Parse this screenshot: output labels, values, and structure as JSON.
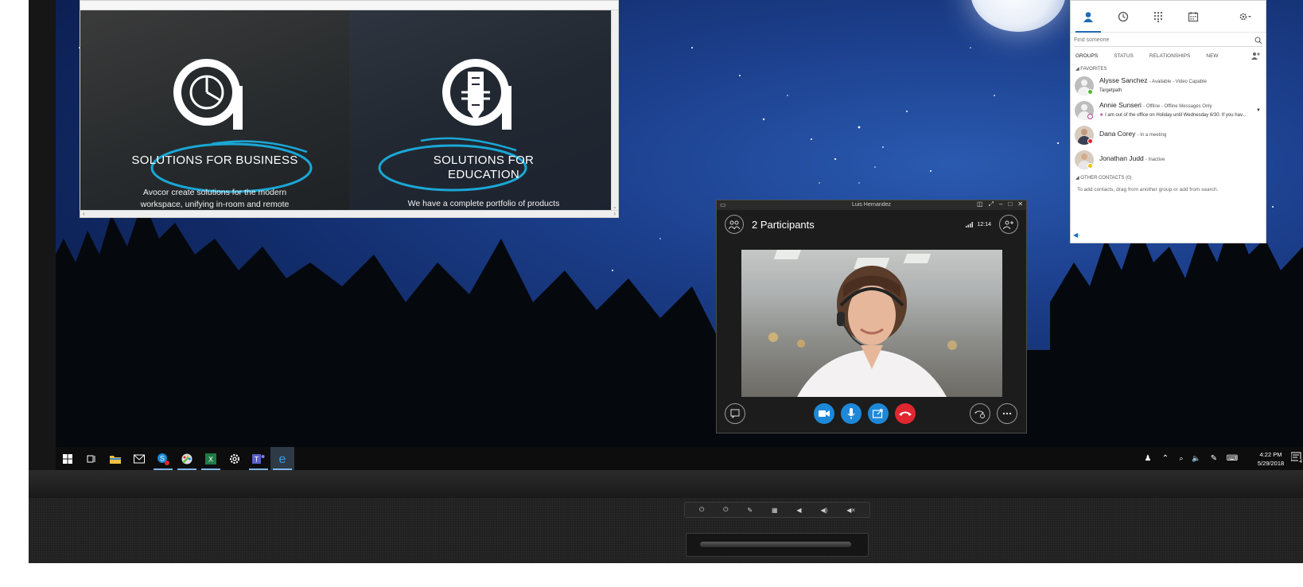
{
  "browser": {
    "panels": [
      {
        "title": "SOLUTIONS FOR BUSINESS",
        "desc_line1": "Avocor create solutions for the modern",
        "desc_line2": "workspace, unifying in-room and remote"
      },
      {
        "title_line1": "SOLUTIONS FOR",
        "title_line2": "EDUCATION",
        "desc_line1": "We have a complete portfolio of products"
      }
    ]
  },
  "contacts": {
    "search_placeholder": "Find someone",
    "subtabs": [
      "GROUPS",
      "STATUS",
      "RELATIONSHIPS",
      "NEW"
    ],
    "favorites_label": "FAVORITES",
    "people": [
      {
        "name": "Alysse Sanchez",
        "status": "- Available - Video Capable",
        "note": "Targetpath",
        "presence": "#58b531"
      },
      {
        "name": "Annie Sunseri",
        "status": "- Offline - Offline Messages Only",
        "note": "I am out of the office on Holiday until Wednesday 6/30.  If you hav...",
        "presence": "#b03c8e"
      },
      {
        "name": "Dana Corey",
        "status": "- In a meeting",
        "note": "",
        "presence": "#d9262f"
      },
      {
        "name": "Jonathan Judd",
        "status": "- Inactive",
        "note": "",
        "presence": "#e8c117"
      }
    ],
    "other_contacts_label": "OTHER CONTACTS (0)",
    "hint": "To add contacts, drag from another group or add from search."
  },
  "call": {
    "window_title": "Luis Hernandez",
    "participants": "2 Participants",
    "time": "12:14"
  },
  "taskbar": {
    "time": "4:22 PM",
    "date": "5/29/2018",
    "notifications": "4"
  },
  "colors": {
    "accent_blue": "#1e88d8",
    "hangup_red": "#e0262f",
    "highlight_cyan": "#1aa7d6"
  },
  "icons": [
    "windows-start-icon",
    "task-view-icon",
    "file-explorer-icon",
    "mail-icon",
    "skype-icon",
    "paint-icon",
    "excel-icon",
    "settings-icon",
    "teams-icon",
    "edge-icon"
  ]
}
